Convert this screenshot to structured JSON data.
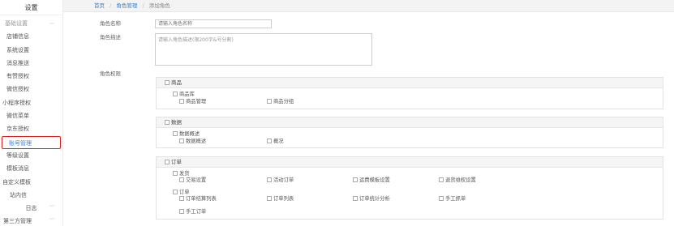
{
  "sidebar": {
    "title": "设置",
    "groups": {
      "basic": "基础设置",
      "log": "日志",
      "third": "第三方管理"
    },
    "items": {
      "store_info": "店铺信息",
      "system_settings": "系统设置",
      "message_push": "消息推送",
      "youzan_auth": "有赞授权",
      "wechat_auth": "微信授权",
      "mini_program_auth": "小程序授权",
      "wechat_menu": "微信菜单",
      "jd_auth": "京东授权",
      "account_management": "账号管理",
      "level_settings": "等级设置",
      "template_message": "模板消息",
      "custom_template": "自定义模板",
      "site_message": "站内信"
    }
  },
  "breadcrumb": {
    "home": "首页",
    "sep1": "/",
    "role_management": "角色管理",
    "sep2": "/",
    "current": "添加角色"
  },
  "form": {
    "role_name_label": "角色名称",
    "role_name_placeholder": "请输入角色名称",
    "role_desc_label": "角色描述",
    "role_desc_placeholder": "请输入角色描述(限200字&号分割)",
    "permission_label": "角色权限"
  },
  "permissions": {
    "product": {
      "title": "商品",
      "sub_title": "商品库",
      "items": [
        "商品管理",
        "商品分组"
      ]
    },
    "data": {
      "title": "数据",
      "sub_title": "数据概述",
      "items": [
        "数据概述",
        "概况"
      ]
    },
    "order": {
      "title": "订单",
      "sub1_title": "发货",
      "sub1_items": [
        "交易设置",
        "活动订单",
        "运费模板设置",
        "退货维权设置"
      ],
      "sub2_title": "订单",
      "sub2_items": [
        "订单结算列表",
        "订单列表",
        "订单统计分析",
        "手工抓单"
      ],
      "sub2_items_row2": [
        "手工订单"
      ]
    }
  }
}
